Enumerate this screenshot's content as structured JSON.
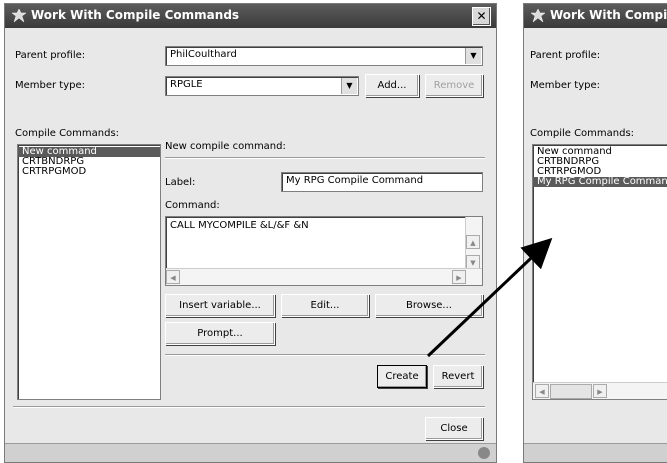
{
  "dialog": {
    "title": "Work With Compile Commands",
    "close_label": "✕",
    "parent_profile_label": "Parent profile:",
    "parent_profile_value": "PhilCoulthard",
    "member_type_label": "Member type:",
    "member_type_value": "RPGLE",
    "add_label": "Add...",
    "remove_label": "Remove",
    "compile_commands_label": "Compile Commands:",
    "commands": [
      "New command",
      "CRTBNDRPG",
      "CRTRPGMOD"
    ],
    "new_compile_command_label": "New compile command:",
    "label_label": "Label:",
    "label_value": "My RPG Compile Command",
    "command_label": "Command:",
    "command_value": "CALL MYCOMPILE &L/&F &N",
    "insert_variable_label": "Insert variable...",
    "edit_label": "Edit...",
    "browse_label": "Browse...",
    "prompt_label": "Prompt...",
    "create_label": "Create",
    "revert_label": "Revert",
    "close_button_label": "Close"
  },
  "dialog2": {
    "title": "Work With Compile",
    "parent_profile_label": "Parent profile:",
    "member_type_label": "Member type:",
    "compile_commands_label": "Compile Commands:",
    "commands": [
      "New command",
      "CRTBNDRPG",
      "CRTRPGMOD",
      "My RPG Compile Command"
    ]
  },
  "colors": {
    "title_bar": "#3a3a3a",
    "selection": "#5a5a5a",
    "window_bg": "#e8e8e8"
  }
}
